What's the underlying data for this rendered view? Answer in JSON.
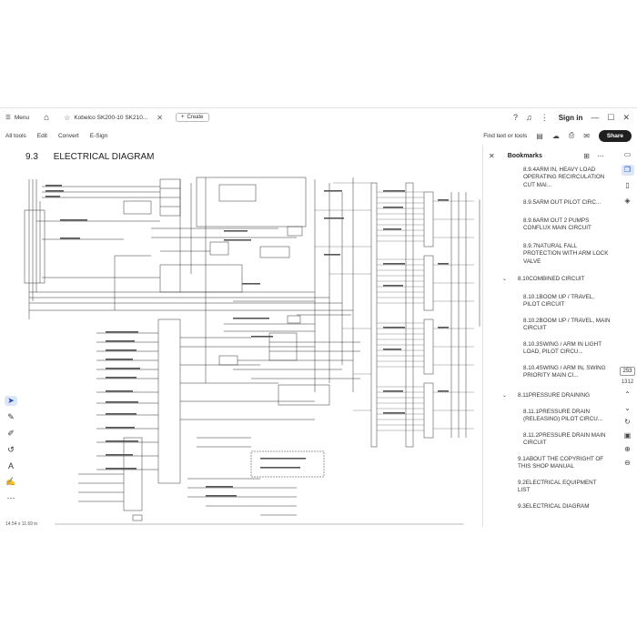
{
  "tabbar": {
    "menu_label": "Menu",
    "tab_title": "Kobelco SK200-10 SK210...",
    "create_label": "Create",
    "signin_label": "Sign in",
    "icons": [
      "menu-icon",
      "home-icon",
      "star-icon",
      "close-icon",
      "plus-icon",
      "help-icon",
      "bell-icon",
      "apps-icon",
      "minimize-icon",
      "maximize-icon",
      "close-window-icon"
    ]
  },
  "menubar": {
    "items": [
      "All tools",
      "Edit",
      "Convert",
      "E-Sign"
    ],
    "find_label": "Find text or tools",
    "share_label": "Share"
  },
  "document": {
    "section_number": "9.3",
    "section_title": "ELECTRICAL DIAGRAM",
    "page_size": "14.54 x 11.69 in"
  },
  "bookmarks": {
    "title": "Bookmarks",
    "items": [
      {
        "level": 2,
        "label": "8.9.4ARM IN, HEAVY LOAD OPERATING RECIRCULATION CUT MAI..."
      },
      {
        "level": 2,
        "label": "8.9.5ARM OUT PILOT CIRC..."
      },
      {
        "level": 2,
        "label": "8.9.6ARM OUT 2 PUMPS CONFLUX MAIN CIRCUIT"
      },
      {
        "level": 2,
        "label": "8.9.7NATURAL FALL PROTECTION WITH ARM LOCK VALVE"
      },
      {
        "level": 1,
        "label": "8.10COMBINED CIRCUIT",
        "expanded": true
      },
      {
        "level": 2,
        "label": "8.10.1BOOM UP / TRAVEL, PILOT CIRCUIT"
      },
      {
        "level": 2,
        "label": "8.10.2BOOM UP / TRAVEL, MAIN CIRCUIT"
      },
      {
        "level": 2,
        "label": "8.10.3SWING / ARM IN LIGHT LOAD, PILOT CIRCU..."
      },
      {
        "level": 2,
        "label": "8.10.4SWING / ARM IN, SWING PRIORITY MAIN CI..."
      },
      {
        "level": 1,
        "label": "8.11PRESSURE DRAINING",
        "expanded": true
      },
      {
        "level": 2,
        "label": "8.11.1PRESSURE DRAIN (RELEASING) PILOT CIRCU..."
      },
      {
        "level": 2,
        "label": "8.11.2PRESSURE DRAIN MAIN CIRCUIT"
      },
      {
        "level": 1,
        "label": "9.1ABOUT THE COPYRIGHT OF THIS SHOP MANUAL"
      },
      {
        "level": 1,
        "label": "9.2ELECTRICAL EQUIPMENT LIST"
      },
      {
        "level": 1,
        "label": "9.3ELECTRICAL DIAGRAM"
      }
    ]
  },
  "pager": {
    "current_page": "253",
    "total_pages": "1312"
  }
}
